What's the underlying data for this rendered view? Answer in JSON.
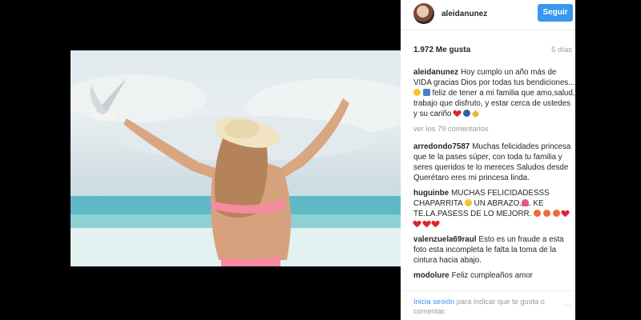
{
  "header": {
    "username": "aleidanunez",
    "follow_label": "Seguir"
  },
  "post": {
    "likes": "1.972 Me gusta",
    "age": "5 días"
  },
  "caption": {
    "user": "aleidanunez",
    "text_part1": "Hoy cumplo un año más de VIDA gracias Dios por todas tus bendiciones...",
    "text_part2": "feliz de tener a mi familia que amo,salud, trabajo que disfruto, y estar cerca de ustedes y su cariño"
  },
  "view_more": "ver los 79 comentarios",
  "comments": [
    {
      "user": "arredondo7587",
      "text": "Muchas felicidades princesa que te la pases súper, con toda tu familia y seres queridos te lo mereces Saludos desde Querétaro eres mi princesa linda."
    },
    {
      "user": "huguinbe",
      "text_part1": "MUCHAS FELICIDADESSS CHAPARRITA",
      "text_part2": "UN ABRAZO.",
      "text_part3": ". KE TE.LA.PASESS DE LO MEJORR."
    },
    {
      "user": "valenzuela69raul",
      "text": "Esto es un fraude a esta foto esta incompleta le falta la toma de la cintura hacia abajo."
    },
    {
      "user": "modolure",
      "text": "Feliz cumpleaños amor"
    }
  ],
  "footer": {
    "login_label": "Inicia sesión",
    "login_rest": "para indicar que te gusta o comentar.",
    "more_icon": "···"
  },
  "colors": {
    "accent": "#3897f0",
    "muted": "#999999",
    "heart": "#e0242f"
  }
}
